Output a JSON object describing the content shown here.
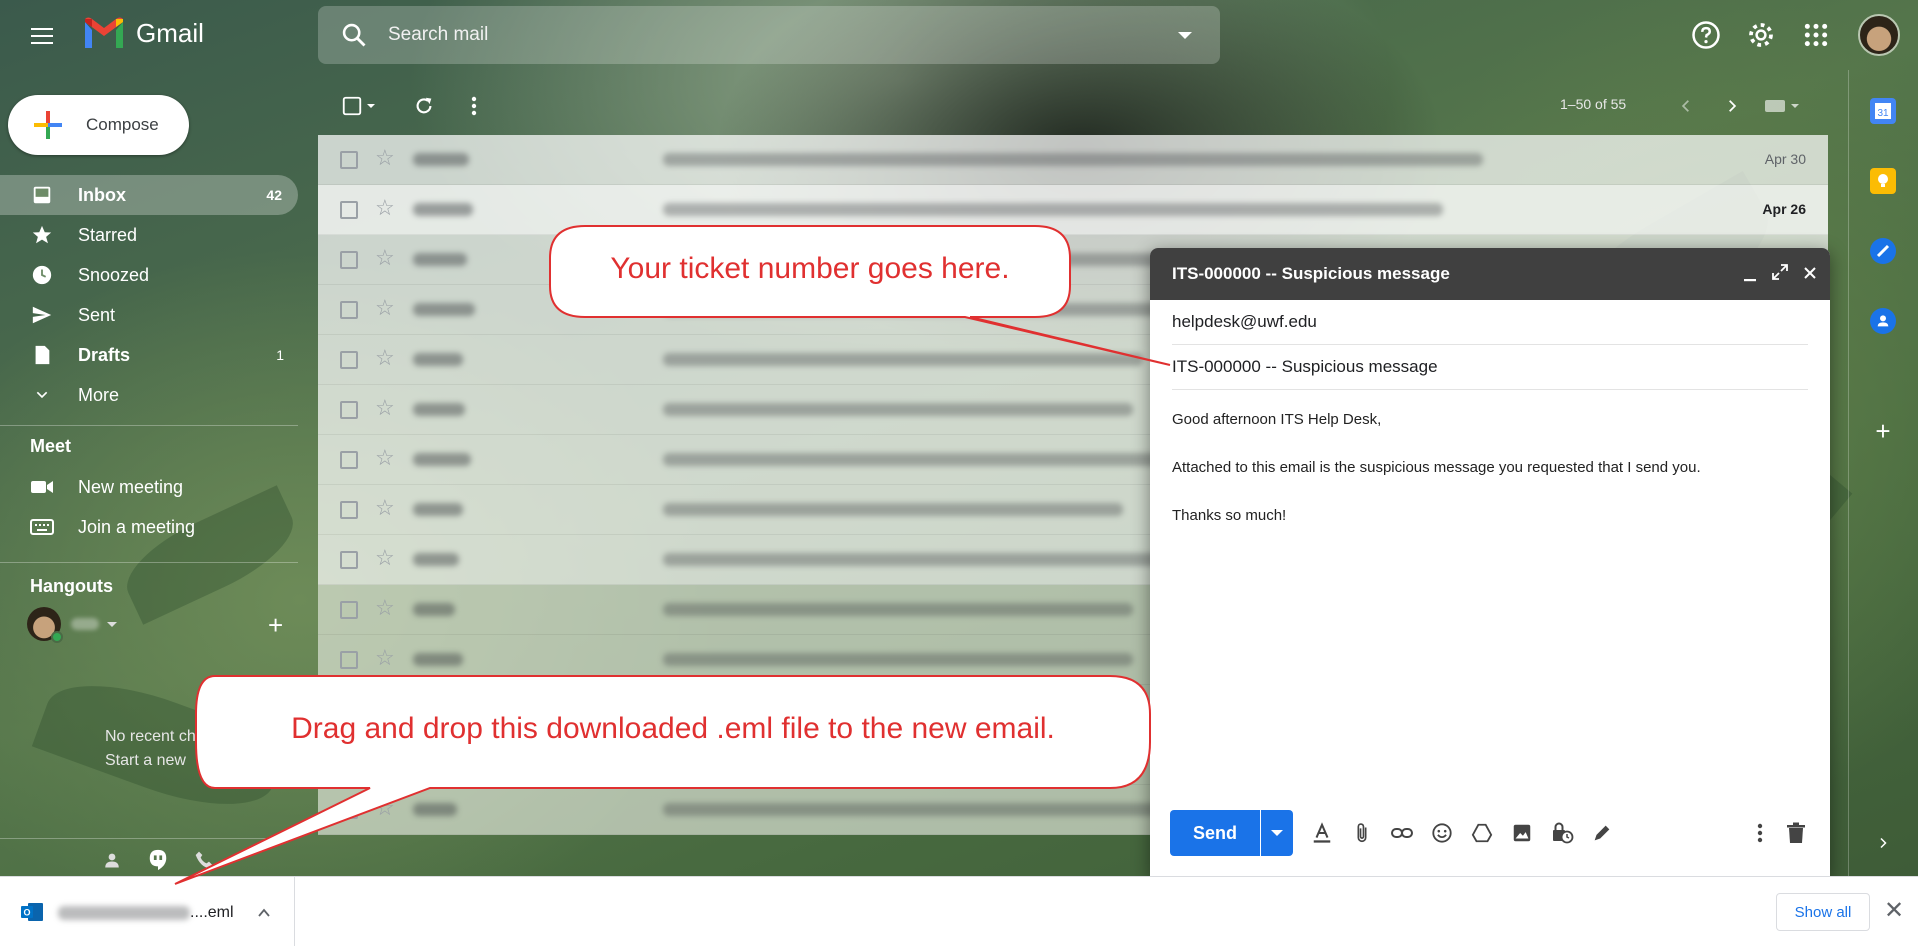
{
  "app": {
    "name": "Gmail"
  },
  "search": {
    "placeholder": "Search mail"
  },
  "sidebar": {
    "compose_label": "Compose",
    "items": [
      {
        "label": "Inbox",
        "count": "42"
      },
      {
        "label": "Starred",
        "count": ""
      },
      {
        "label": "Snoozed",
        "count": ""
      },
      {
        "label": "Sent",
        "count": ""
      },
      {
        "label": "Drafts",
        "count": "1"
      },
      {
        "label": "More",
        "count": ""
      }
    ],
    "meet": {
      "title": "Meet",
      "new_meeting": "New meeting",
      "join_meeting": "Join a meeting"
    },
    "hangouts": {
      "title": "Hangouts",
      "no_recent_line1": "No recent ch",
      "no_recent_line2": "Start a new"
    }
  },
  "toolbar": {
    "pagination": "1–50 of 55"
  },
  "emails": [
    {
      "date": "Apr 30",
      "unread": false
    },
    {
      "date": "Apr 26",
      "unread": true
    },
    {
      "date": "",
      "unread": false
    },
    {
      "date": "",
      "unread": false
    },
    {
      "date": "",
      "unread": false
    },
    {
      "date": "",
      "unread": false
    },
    {
      "date": "",
      "unread": false
    },
    {
      "date": "",
      "unread": false
    },
    {
      "date": "",
      "unread": false
    },
    {
      "date": "",
      "unread": false
    },
    {
      "date": "",
      "unread": false
    },
    {
      "date": "",
      "unread": false
    },
    {
      "date": "",
      "unread": false
    },
    {
      "date": "",
      "unread": false
    }
  ],
  "compose_window": {
    "title": "ITS-000000 -- Suspicious message",
    "to": "helpdesk@uwf.edu",
    "subject": "ITS-000000 -- Suspicious message",
    "body": [
      "Good afternoon ITS Help Desk,",
      "Attached to this email is the suspicious message you requested that I send you.",
      "Thanks so much!"
    ],
    "send_label": "Send"
  },
  "callouts": {
    "ticket": "Your ticket number goes here.",
    "drag": "Drag and drop this downloaded .eml file to the new email."
  },
  "download_bar": {
    "file_suffix": "....eml",
    "show_all": "Show all"
  },
  "colors": {
    "accent": "#1a73e8",
    "callout_red": "#e03030",
    "compose_header": "#404040"
  }
}
